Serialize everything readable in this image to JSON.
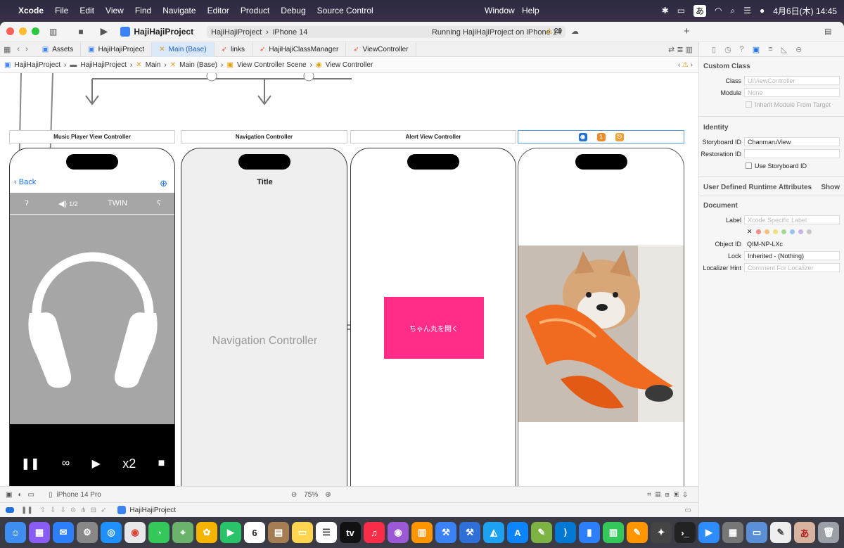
{
  "menubar": {
    "app": "Xcode",
    "items": [
      "File",
      "Edit",
      "View",
      "Find",
      "Navigate",
      "Editor",
      "Product",
      "Debug",
      "Source Control"
    ],
    "right_items": [
      "Window",
      "Help"
    ],
    "ime": "あ",
    "datetime": "4月6日(木)  14:45"
  },
  "toolbar": {
    "project": "HajiHajiProject",
    "scheme": "HajiHajiProject",
    "device": "iPhone 14",
    "status": "Running HajiHajiProject on iPhone 14",
    "warnings": "29"
  },
  "tabs": [
    {
      "label": "Assets"
    },
    {
      "label": "HajiHajiProject"
    },
    {
      "label": "Main (Base)"
    },
    {
      "label": "links"
    },
    {
      "label": "HajiHajiClassManager"
    },
    {
      "label": "ViewController"
    }
  ],
  "jumpbar": [
    "HajiHajiProject",
    "HajiHajiProject",
    "Main",
    "Main (Base)",
    "View Controller Scene",
    "View Controller"
  ],
  "scenes": {
    "music": {
      "title": "Music Player View Controller",
      "back": "Back",
      "controls": [
        "1/2",
        "TWIN"
      ],
      "bottom": [
        "∞",
        "x2"
      ]
    },
    "nav": {
      "title": "Navigation Controller",
      "nav_title": "Title",
      "center": "Navigation Controller"
    },
    "alert": {
      "title": "Alert View Controller",
      "button": "ちゃん丸を開く",
      "button_color": "#ff2d87"
    },
    "chanmaru": {
      "badge": "1"
    }
  },
  "bottom": {
    "device": "iPhone 14 Pro",
    "zoom": "75%"
  },
  "debug": {
    "target": "HajiHajiProject"
  },
  "inspector": {
    "custom_class": "Custom Class",
    "class_label": "Class",
    "class_placeholder": "UIViewController",
    "module_label": "Module",
    "module_placeholder": "None",
    "inherit": "Inherit Module From Target",
    "identity": "Identity",
    "storyboard_id_label": "Storyboard ID",
    "storyboard_id": "ChanmaruView",
    "restoration_label": "Restoration ID",
    "use_storyboard": "Use Storyboard ID",
    "udra": "User Defined Runtime Attributes",
    "show": "Show",
    "document": "Document",
    "label_label": "Label",
    "label_placeholder": "Xcode Specific Label",
    "object_id_label": "Object ID",
    "object_id": "QIM-NP-LXc",
    "lock_label": "Lock",
    "lock": "Inherited - (Nothing)",
    "localizer_label": "Localizer Hint",
    "localizer_placeholder": "Comment For Localizer"
  }
}
